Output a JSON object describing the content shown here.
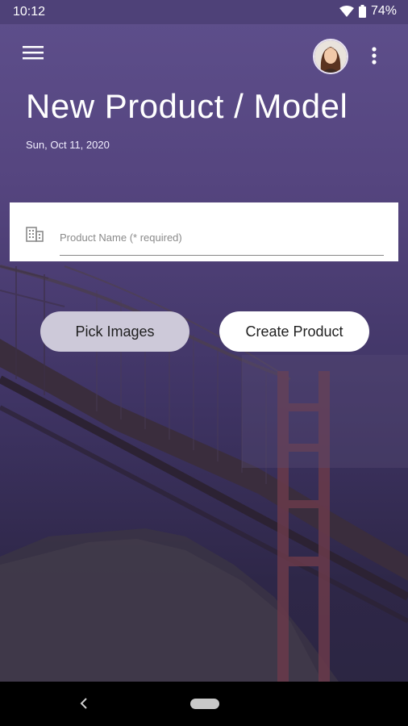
{
  "status_bar": {
    "time": "10:12",
    "battery": "74%",
    "icons": [
      "wifi-icon",
      "battery-icon"
    ]
  },
  "header": {
    "menu_icon": "hamburger-menu-icon",
    "overflow_icon": "more-vert-icon",
    "title": "New Product / Model",
    "date": "Sun, Oct 11, 2020"
  },
  "form": {
    "product_name": {
      "icon": "building-icon",
      "value": "",
      "placeholder": "Product Name (* required)"
    }
  },
  "actions": {
    "pick_images": "Pick Images",
    "create_product": "Create Product"
  },
  "nav": {
    "back_icon": "back-chevron-icon",
    "home_icon": "home-pill-icon"
  },
  "colors": {
    "header_purple": "#5e4f8c",
    "status_bar": "#4e4178",
    "pick_button": "#cdc9d9",
    "create_button": "#ffffff"
  }
}
